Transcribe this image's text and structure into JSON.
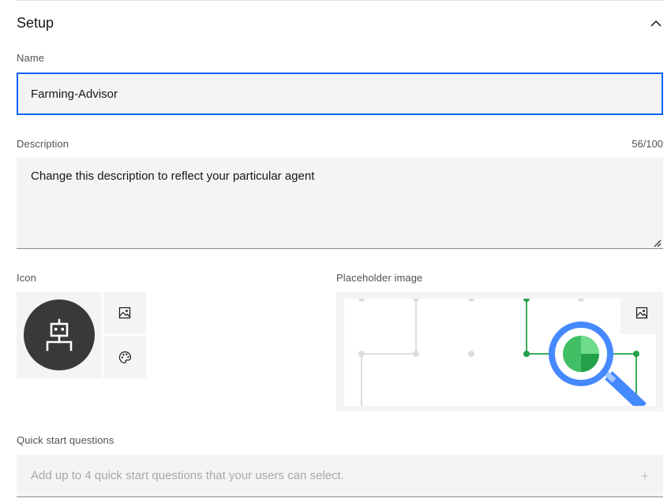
{
  "section": {
    "title": "Setup",
    "collapse_icon": "chevron-up-icon"
  },
  "name": {
    "label": "Name",
    "value": "Farming-Advisor"
  },
  "description": {
    "label": "Description",
    "counter": "56/100",
    "value": "Change this description to reflect your particular agent"
  },
  "icon": {
    "label": "Icon",
    "avatar_icon": "robot-icon",
    "upload_icon": "image-icon",
    "color_icon": "palette-icon"
  },
  "placeholder_image": {
    "label": "Placeholder image",
    "upload_icon": "image-icon"
  },
  "quick_start": {
    "label": "Quick start questions",
    "placeholder": "Add up to 4 quick start questions that your users can select.",
    "add_icon": "+"
  },
  "colors": {
    "focus": "#0f62fe",
    "field_bg": "#f4f4f4",
    "avatar_bg": "#393939",
    "accent_green": "#24a148",
    "accent_blue": "#4589ff"
  }
}
